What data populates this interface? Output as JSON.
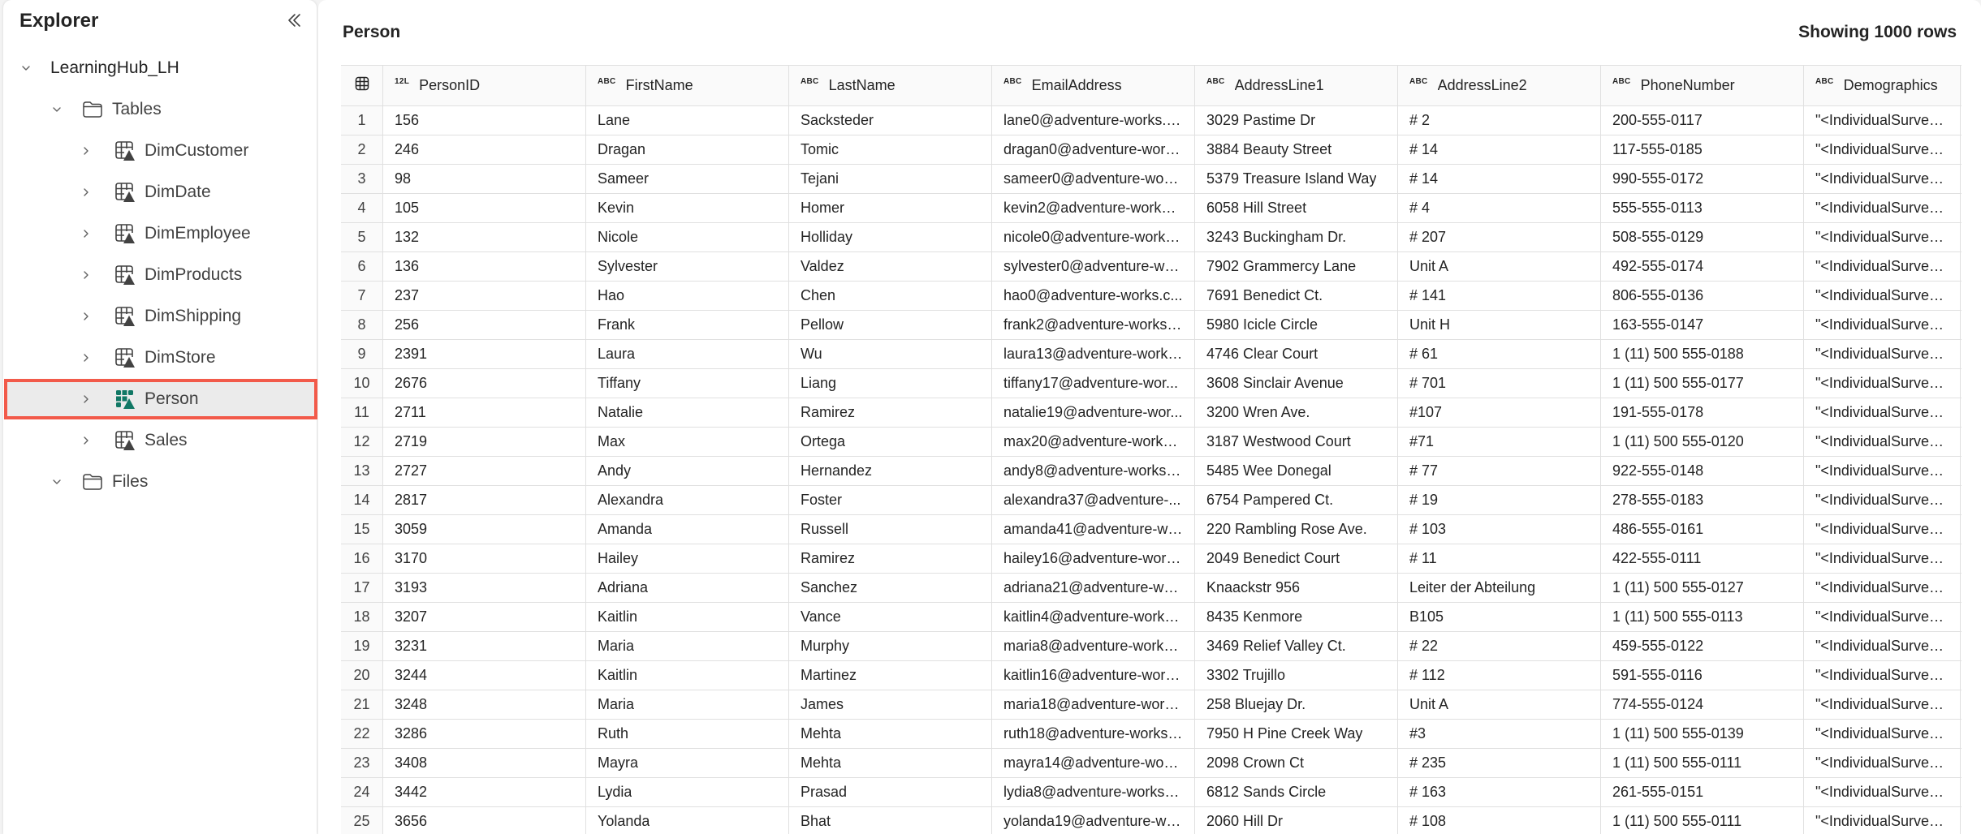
{
  "explorer": {
    "title": "Explorer",
    "collapse_icon": "double-chevron-left-icon",
    "tree": [
      {
        "label": "LearningHub_LH",
        "level": 0,
        "expanded": true,
        "icon": "none"
      },
      {
        "label": "Tables",
        "level": 1,
        "expanded": true,
        "icon": "folder-icon"
      },
      {
        "label": "DimCustomer",
        "level": 2,
        "expanded": false,
        "icon": "delta-table-icon"
      },
      {
        "label": "DimDate",
        "level": 2,
        "expanded": false,
        "icon": "delta-table-icon"
      },
      {
        "label": "DimEmployee",
        "level": 2,
        "expanded": false,
        "icon": "delta-table-icon"
      },
      {
        "label": "DimProducts",
        "level": 2,
        "expanded": false,
        "icon": "delta-table-icon"
      },
      {
        "label": "DimShipping",
        "level": 2,
        "expanded": false,
        "icon": "delta-table-icon"
      },
      {
        "label": "DimStore",
        "level": 2,
        "expanded": false,
        "icon": "delta-table-icon"
      },
      {
        "label": "Person",
        "level": 2,
        "expanded": false,
        "icon": "delta-table-icon",
        "selected": true
      },
      {
        "label": "Sales",
        "level": 2,
        "expanded": false,
        "icon": "delta-table-icon"
      },
      {
        "label": "Files",
        "level": 1,
        "expanded": true,
        "icon": "folder-icon"
      }
    ]
  },
  "main": {
    "title": "Person",
    "row_count": "Showing 1000 rows",
    "accent_highlight": "#f25a4a",
    "selected_color": "#117865",
    "columns": [
      {
        "name": "PersonID",
        "type": "12L"
      },
      {
        "name": "FirstName",
        "type": "ABC"
      },
      {
        "name": "LastName",
        "type": "ABC"
      },
      {
        "name": "EmailAddress",
        "type": "ABC"
      },
      {
        "name": "AddressLine1",
        "type": "ABC"
      },
      {
        "name": "AddressLine2",
        "type": "ABC"
      },
      {
        "name": "PhoneNumber",
        "type": "ABC"
      },
      {
        "name": "Demographics",
        "type": "ABC"
      }
    ],
    "rows": [
      [
        "1",
        "156",
        "Lane",
        "Sacksteder",
        "lane0@adventure-works.c...",
        "3029 Pastime Dr",
        "# 2",
        "200-555-0117",
        "\"<IndividualSurvey ..."
      ],
      [
        "2",
        "246",
        "Dragan",
        "Tomic",
        "dragan0@adventure-work...",
        "3884 Beauty Street",
        "# 14",
        "117-555-0185",
        "\"<IndividualSurvey ..."
      ],
      [
        "3",
        "98",
        "Sameer",
        "Tejani",
        "sameer0@adventure-work...",
        "5379 Treasure Island Way",
        "# 14",
        "990-555-0172",
        "\"<IndividualSurvey ..."
      ],
      [
        "4",
        "105",
        "Kevin",
        "Homer",
        "kevin2@adventure-works....",
        "6058 Hill Street",
        "# 4",
        "555-555-0113",
        "\"<IndividualSurvey ..."
      ],
      [
        "5",
        "132",
        "Nicole",
        "Holliday",
        "nicole0@adventure-works....",
        "3243 Buckingham Dr.",
        "# 207",
        "508-555-0129",
        "\"<IndividualSurvey ..."
      ],
      [
        "6",
        "136",
        "Sylvester",
        "Valdez",
        "sylvester0@adventure-wor...",
        "7902 Grammercy Lane",
        "Unit A",
        "492-555-0174",
        "\"<IndividualSurvey ..."
      ],
      [
        "7",
        "237",
        "Hao",
        "Chen",
        "hao0@adventure-works.c...",
        "7691 Benedict Ct.",
        "# 141",
        "806-555-0136",
        "\"<IndividualSurvey ..."
      ],
      [
        "8",
        "256",
        "Frank",
        "Pellow",
        "frank2@adventure-works....",
        "5980 Icicle Circle",
        "Unit H",
        "163-555-0147",
        "\"<IndividualSurvey ..."
      ],
      [
        "9",
        "2391",
        "Laura",
        "Wu",
        "laura13@adventure-works...",
        "4746 Clear Court",
        "# 61",
        "1 (11) 500 555-0188",
        "\"<IndividualSurvey ..."
      ],
      [
        "10",
        "2676",
        "Tiffany",
        "Liang",
        "tiffany17@adventure-wor...",
        "3608 Sinclair Avenue",
        "# 701",
        "1 (11) 500 555-0177",
        "\"<IndividualSurvey ..."
      ],
      [
        "11",
        "2711",
        "Natalie",
        "Ramirez",
        "natalie19@adventure-wor...",
        "3200 Wren Ave.",
        "#107",
        "191-555-0178",
        "\"<IndividualSurvey ..."
      ],
      [
        "12",
        "2719",
        "Max",
        "Ortega",
        "max20@adventure-works....",
        "3187 Westwood Court",
        "#71",
        "1 (11) 500 555-0120",
        "\"<IndividualSurvey ..."
      ],
      [
        "13",
        "2727",
        "Andy",
        "Hernandez",
        "andy8@adventure-works.c...",
        "5485 Wee Donegal",
        "# 77",
        "922-555-0148",
        "\"<IndividualSurvey ..."
      ],
      [
        "14",
        "2817",
        "Alexandra",
        "Foster",
        "alexandra37@adventure-...",
        "6754 Pampered Ct.",
        "# 19",
        "278-555-0183",
        "\"<IndividualSurvey ..."
      ],
      [
        "15",
        "3059",
        "Amanda",
        "Russell",
        "amanda41@adventure-wo...",
        "220 Rambling Rose Ave.",
        "# 103",
        "486-555-0161",
        "\"<IndividualSurvey ..."
      ],
      [
        "16",
        "3170",
        "Hailey",
        "Ramirez",
        "hailey16@adventure-work...",
        "2049 Benedict Court",
        "# 11",
        "422-555-0111",
        "\"<IndividualSurvey ..."
      ],
      [
        "17",
        "3193",
        "Adriana",
        "Sanchez",
        "adriana21@adventure-wo...",
        "Knaackstr 956",
        "Leiter der Abteilung",
        "1 (11) 500 555-0127",
        "\"<IndividualSurvey ..."
      ],
      [
        "18",
        "3207",
        "Kaitlin",
        "Vance",
        "kaitlin4@adventure-works....",
        "8435 Kenmore",
        "B105",
        "1 (11) 500 555-0113",
        "\"<IndividualSurvey ..."
      ],
      [
        "19",
        "3231",
        "Maria",
        "Murphy",
        "maria8@adventure-works....",
        "3469 Relief Valley Ct.",
        "# 22",
        "459-555-0122",
        "\"<IndividualSurvey ..."
      ],
      [
        "20",
        "3244",
        "Kaitlin",
        "Martinez",
        "kaitlin16@adventure-work...",
        "3302 Trujillo",
        "# 112",
        "591-555-0116",
        "\"<IndividualSurvey ..."
      ],
      [
        "21",
        "3248",
        "Maria",
        "James",
        "maria18@adventure-work...",
        "258 Bluejay Dr.",
        "Unit A",
        "774-555-0124",
        "\"<IndividualSurvey ..."
      ],
      [
        "22",
        "3286",
        "Ruth",
        "Mehta",
        "ruth18@adventure-works....",
        "7950 H Pine Creek Way",
        "#3",
        "1 (11) 500 555-0139",
        "\"<IndividualSurvey ..."
      ],
      [
        "23",
        "3408",
        "Mayra",
        "Mehta",
        "mayra14@adventure-work...",
        "2098 Crown Ct",
        "# 235",
        "1 (11) 500 555-0111",
        "\"<IndividualSurvey ..."
      ],
      [
        "24",
        "3442",
        "Lydia",
        "Prasad",
        "lydia8@adventure-works.c...",
        "6812 Sands Circle",
        "# 163",
        "261-555-0151",
        "\"<IndividualSurvey ..."
      ],
      [
        "25",
        "3656",
        "Yolanda",
        "Bhat",
        "yolanda19@adventure-wo...",
        "2060 Hill Dr",
        "# 108",
        "1 (11) 500 555-0111",
        "\"<IndividualSurvey ..."
      ]
    ]
  }
}
